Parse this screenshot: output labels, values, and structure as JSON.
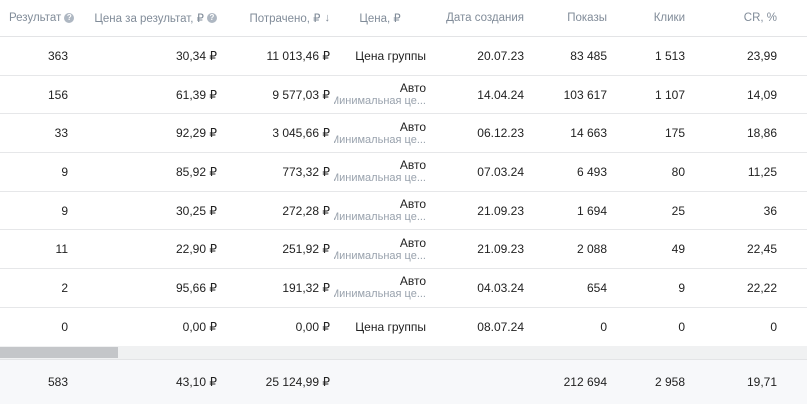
{
  "header": {
    "result": "Результат",
    "cost_per_result": "Цена за результат, ₽",
    "spent": "Потрачено, ₽",
    "sort_arrow": "↓",
    "price": "Цена, ₽",
    "created": "Дата создания",
    "impressions": "Показы",
    "clicks": "Клики",
    "cr": "CR, %"
  },
  "rows": [
    {
      "result": "363",
      "cpr": "30,34 ₽",
      "spent": "11 013,46 ₽",
      "price": "Цена группы",
      "price_sub": "",
      "date": "20.07.23",
      "imp": "83 485",
      "clicks": "1 513",
      "cr": "23,99"
    },
    {
      "result": "156",
      "cpr": "61,39 ₽",
      "spent": "9 577,03 ₽",
      "price": "Авто",
      "price_sub": "Минимальная це...",
      "date": "14.04.24",
      "imp": "103 617",
      "clicks": "1 107",
      "cr": "14,09"
    },
    {
      "result": "33",
      "cpr": "92,29 ₽",
      "spent": "3 045,66 ₽",
      "price": "Авто",
      "price_sub": "Минимальная це...",
      "date": "06.12.23",
      "imp": "14 663",
      "clicks": "175",
      "cr": "18,86"
    },
    {
      "result": "9",
      "cpr": "85,92 ₽",
      "spent": "773,32 ₽",
      "price": "Авто",
      "price_sub": "Минимальная це...",
      "date": "07.03.24",
      "imp": "6 493",
      "clicks": "80",
      "cr": "11,25"
    },
    {
      "result": "9",
      "cpr": "30,25 ₽",
      "spent": "272,28 ₽",
      "price": "Авто",
      "price_sub": "Минимальная це...",
      "date": "21.09.23",
      "imp": "1 694",
      "clicks": "25",
      "cr": "36"
    },
    {
      "result": "11",
      "cpr": "22,90 ₽",
      "spent": "251,92 ₽",
      "price": "Авто",
      "price_sub": "Минимальная це...",
      "date": "21.09.23",
      "imp": "2 088",
      "clicks": "49",
      "cr": "22,45"
    },
    {
      "result": "2",
      "cpr": "95,66 ₽",
      "spent": "191,32 ₽",
      "price": "Авто",
      "price_sub": "Минимальная це...",
      "date": "04.03.24",
      "imp": "654",
      "clicks": "9",
      "cr": "22,22"
    },
    {
      "result": "0",
      "cpr": "0,00 ₽",
      "spent": "0,00 ₽",
      "price": "Цена группы",
      "price_sub": "",
      "date": "08.07.24",
      "imp": "0",
      "clicks": "0",
      "cr": "0"
    }
  ],
  "totals": {
    "result": "583",
    "cpr": "43,10 ₽",
    "spent": "25 124,99 ₽",
    "imp": "212 694",
    "clicks": "2 958",
    "cr": "19,71"
  },
  "icons": {
    "help": "question-circle-icon",
    "sort": "arrow-down-icon"
  },
  "colors": {
    "header_text": "#818c99",
    "sub_text": "#99a2ad",
    "footer_bg": "#f7f8fa",
    "scroll_thumb": "#c4c6c9"
  },
  "horizontal_scroll_position": 0
}
